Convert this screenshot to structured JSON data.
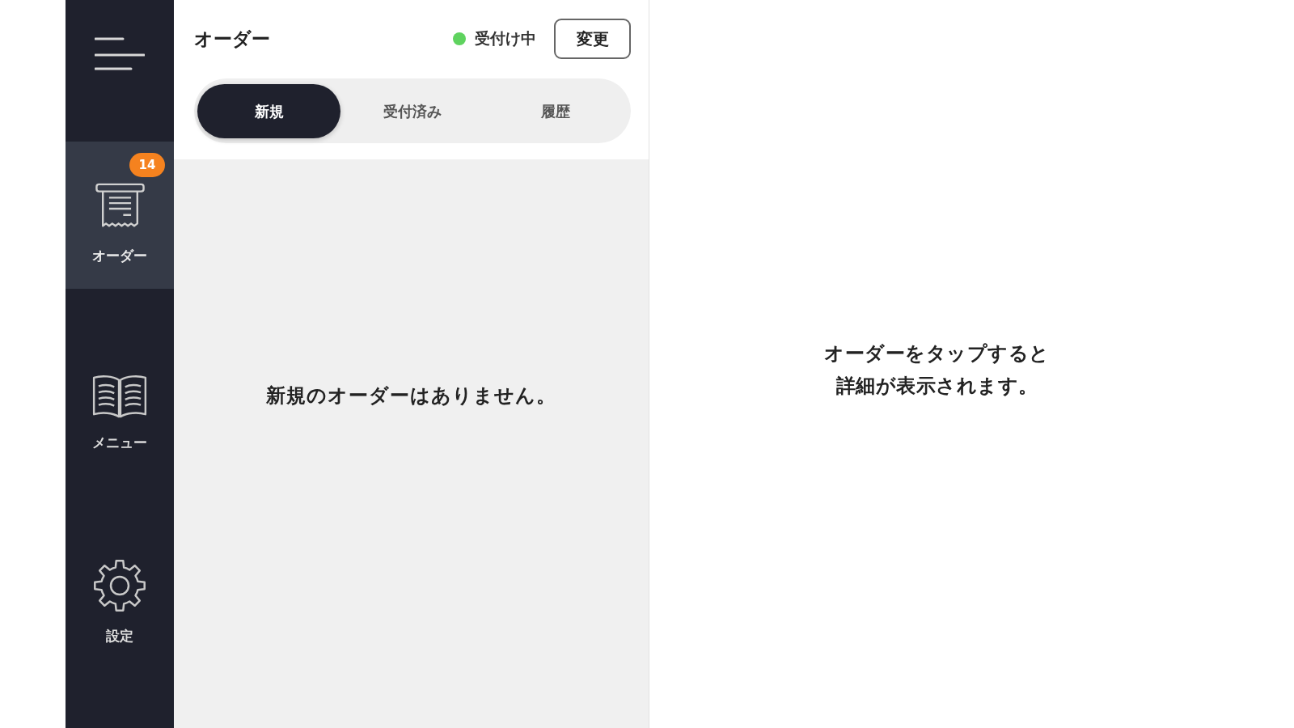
{
  "sidebar": {
    "items": [
      {
        "label": "オーダー",
        "selected": true,
        "badge": "14"
      },
      {
        "label": "メニュー",
        "selected": false
      },
      {
        "label": "設定",
        "selected": false
      }
    ]
  },
  "header": {
    "title": "オーダー",
    "status": {
      "label": "受付け中",
      "on": true
    },
    "button": "変更"
  },
  "tabs": [
    {
      "label": "新規",
      "selected": true
    },
    {
      "label": "受付済み",
      "selected": false
    },
    {
      "label": "履歴",
      "selected": false
    }
  ],
  "order_list": {
    "empty_message": "新規のオーダーはありません。"
  },
  "detail": {
    "message": "オーダーをタップすると詳細が表示されます。"
  }
}
